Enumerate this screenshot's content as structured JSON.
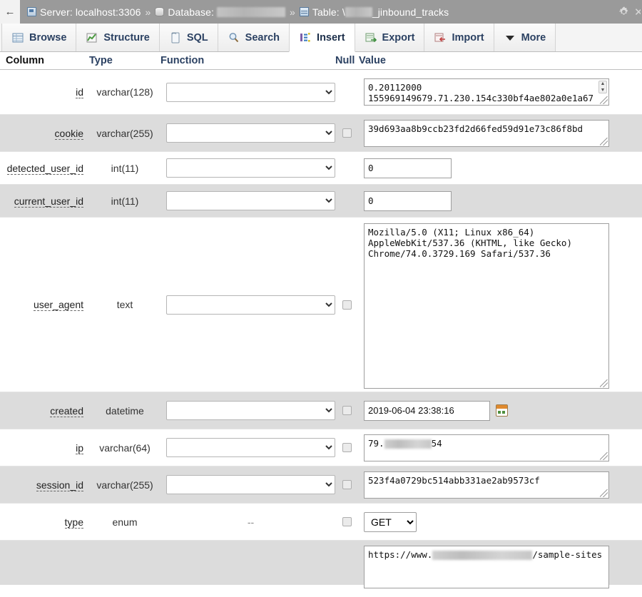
{
  "breadcrumb": {
    "back_label": "←",
    "server_icon": "server-icon",
    "server_label": "Server: localhost:3306",
    "sep1": "»",
    "database_icon": "database-icon",
    "database_label": "Database:",
    "database_value_redacted": true,
    "sep2": "»",
    "table_icon": "table-icon",
    "table_label": "Table:",
    "table_prefix_visible": "\\",
    "table_suffix": "_jinbound_tracks",
    "gear_icon": "gear-icon"
  },
  "tabs": [
    {
      "label": "Browse",
      "icon": "browse-icon",
      "active": false
    },
    {
      "label": "Structure",
      "icon": "structure-icon",
      "active": false
    },
    {
      "label": "SQL",
      "icon": "sql-icon",
      "active": false
    },
    {
      "label": "Search",
      "icon": "search-icon",
      "active": false
    },
    {
      "label": "Insert",
      "icon": "insert-icon",
      "active": true
    },
    {
      "label": "Export",
      "icon": "export-icon",
      "active": false
    },
    {
      "label": "Import",
      "icon": "import-icon",
      "active": false
    },
    {
      "label": "More",
      "icon": "chevron-down-icon",
      "active": false
    }
  ],
  "headers": {
    "column": "Column",
    "type": "Type",
    "function": "Function",
    "null": "Null",
    "value": "Value"
  },
  "function_placeholder": "",
  "rows": [
    {
      "column": "id",
      "type": "varchar(128)",
      "function": "",
      "has_null": false,
      "null_checked": false,
      "value": "0.20112000 155969149679.71.230.154c330bf4ae802a0e1a67",
      "value_line1": "0.20112000",
      "value_line2": "155969149679.71.230.154c330bf4ae802a0e1a67",
      "control": "textarea-scroll"
    },
    {
      "column": "cookie",
      "type": "varchar(255)",
      "function": "",
      "has_null": true,
      "null_checked": false,
      "value": "39d693aa8b9ccb23fd2d66fed59d91e73c86f8bd",
      "control": "textarea"
    },
    {
      "column": "detected_user_id",
      "type": "int(11)",
      "function": "",
      "has_null": false,
      "null_checked": false,
      "value": "0",
      "control": "input-number"
    },
    {
      "column": "current_user_id",
      "type": "int(11)",
      "function": "",
      "has_null": false,
      "null_checked": false,
      "value": "0",
      "control": "input-number"
    },
    {
      "column": "user_agent",
      "type": "text",
      "function": "",
      "has_null": true,
      "null_checked": false,
      "value": "Mozilla/5.0 (X11; Linux x86_64) AppleWebKit/537.36 (KHTML, like Gecko) Chrome/74.0.3729.169 Safari/537.36",
      "value_line1": "Mozilla/5.0 (X11; Linux x86_64)",
      "value_line2": "AppleWebKit/537.36 (KHTML, like Gecko)",
      "value_line3": "Chrome/74.0.3729.169 Safari/537.36",
      "control": "textarea-large"
    },
    {
      "column": "created",
      "type": "datetime",
      "function": "",
      "has_null": true,
      "null_checked": false,
      "value": "2019-06-04 23:38:16",
      "control": "input-datetime",
      "calendar_icon": "calendar-icon"
    },
    {
      "column": "ip",
      "type": "varchar(64)",
      "function": "",
      "has_null": true,
      "null_checked": false,
      "value_prefix": "79.",
      "value_suffix": "54",
      "value_redacted": true,
      "control": "textarea-redacted"
    },
    {
      "column": "session_id",
      "type": "varchar(255)",
      "function": "",
      "has_null": true,
      "null_checked": false,
      "value": "523f4a0729bc514abb331ae2ab9573cf",
      "control": "textarea"
    },
    {
      "column": "type",
      "type": "enum",
      "function": "--",
      "has_null": true,
      "null_checked": false,
      "value": "GET",
      "options": [
        "GET"
      ],
      "control": "select-enum"
    }
  ],
  "last_partial_row": {
    "value_prefix": "https://www.",
    "value_suffix": "/sample-sites",
    "value_redacted": true,
    "control": "textarea-redacted"
  }
}
